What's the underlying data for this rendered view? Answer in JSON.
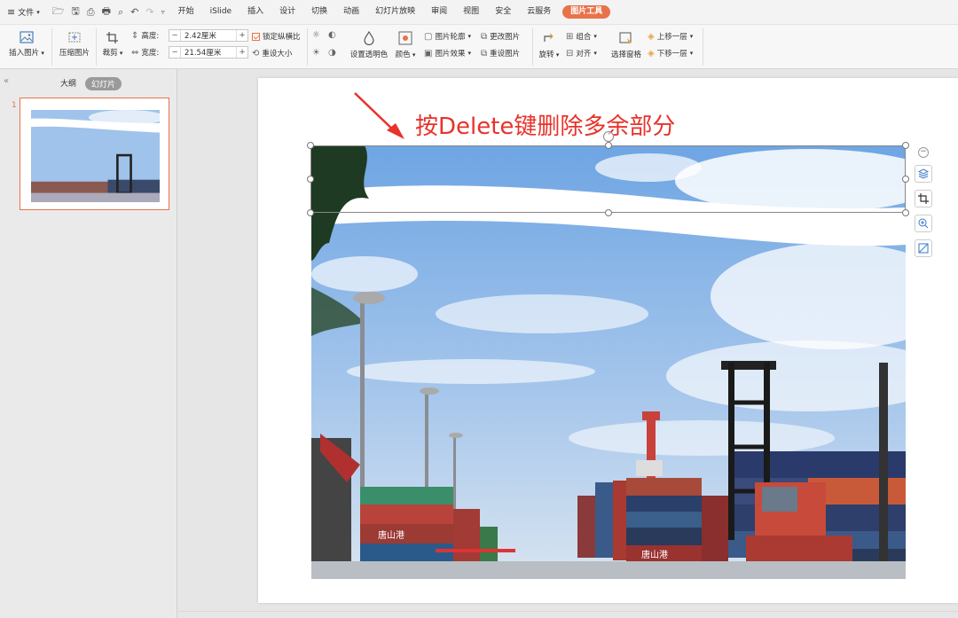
{
  "menubar": {
    "file_label": "文件",
    "tabs": [
      "开始",
      "iSlide",
      "插入",
      "设计",
      "切换",
      "动画",
      "幻灯片放映",
      "审阅",
      "视图",
      "安全",
      "云服务"
    ],
    "active_tab": "图片工具"
  },
  "ribbon": {
    "insert_picture": "插入图片",
    "compress_picture": "压缩图片",
    "crop": "裁剪",
    "height_label": "高度:",
    "height_value": "2.42厘米",
    "width_label": "宽度:",
    "width_value": "21.54厘米",
    "minus": "−",
    "plus": "+",
    "lock_ratio": "锁定纵横比",
    "reset_size": "重设大小",
    "set_transparent": "设置透明色",
    "color": "颜色",
    "picture_outline": "图片轮廓",
    "picture_effect": "图片效果",
    "change_picture": "更改图片",
    "reset_picture": "重设图片",
    "rotate": "旋转",
    "group": "组合",
    "align": "对齐",
    "select_pane": "选择窗格",
    "bring_forward": "上移一层",
    "send_backward": "下移一层"
  },
  "panel": {
    "outline_tab": "大纲",
    "slides_tab": "幻灯片",
    "slide_number": "1"
  },
  "slide": {
    "annotation": "按Delete键删除多余部分",
    "signs": {
      "port_name_1": "唐山港",
      "port_name_2": "唐山港"
    }
  },
  "colors": {
    "accent": "#e8734a",
    "annotation_red": "#e8322a"
  }
}
